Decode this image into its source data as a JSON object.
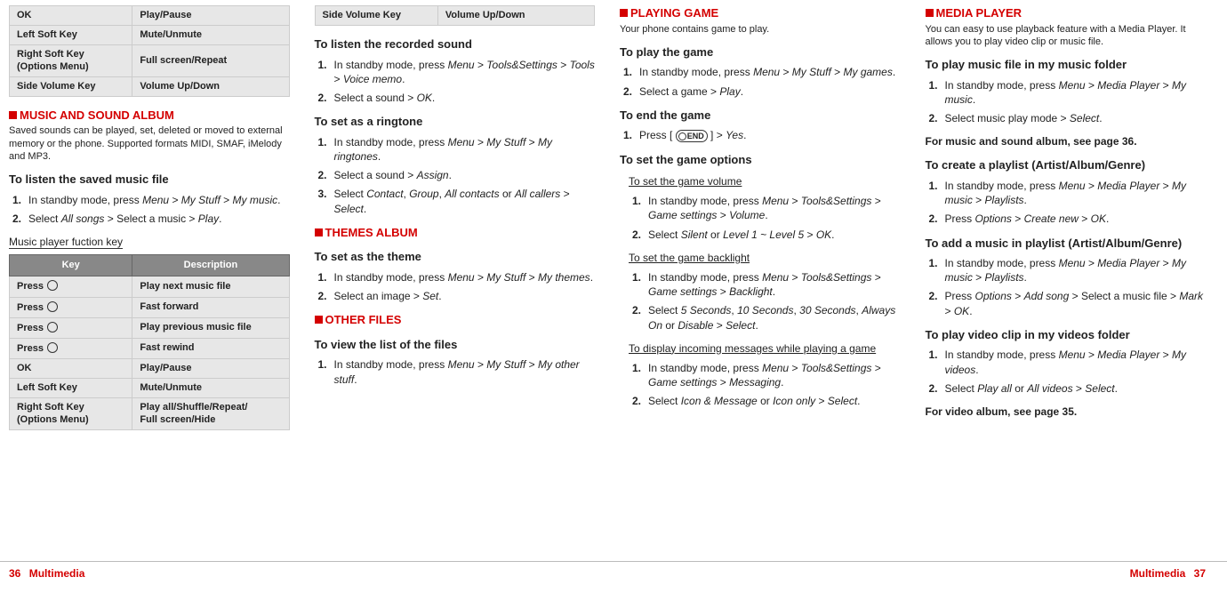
{
  "footer": {
    "left_num": "36",
    "left_name": "Multimedia",
    "right_name": "Multimedia",
    "right_num": "37"
  },
  "col1": {
    "top_table": [
      {
        "k": "OK",
        "d": "Play/Pause"
      },
      {
        "k": "Left Soft Key",
        "d": "Mute/Unmute"
      },
      {
        "k": "Right Soft Key\n(Options Menu)",
        "d": "Full screen/Repeat"
      },
      {
        "k": "Side Volume Key",
        "d": "Volume Up/Down"
      }
    ],
    "h1": "MUSIC AND SOUND ALBUM",
    "h1_sub": "Saved sounds can be played, set, deleted or moved to external memory or the phone. Supported formats MIDI, SMAF, iMelody and MP3.",
    "h2": "To listen the saved music file",
    "listen_list": [
      "In standby mode, press <i>Menu</i> > <i>My Stuff</i> > <i>My music</i>.",
      "Select <i>All songs</i> > Select a music > <i>Play</i>."
    ],
    "h3": "Music player fuction key",
    "table2_headers": {
      "key": "Key",
      "desc": "Description"
    },
    "table2": [
      {
        "k": "Press",
        "icon": true,
        "d": "Play next music file"
      },
      {
        "k": "Press",
        "icon": true,
        "d": "Fast forward"
      },
      {
        "k": "Press",
        "icon": true,
        "d": "Play previous music file"
      },
      {
        "k": "Press",
        "icon": true,
        "d": "Fast rewind"
      },
      {
        "k": "OK",
        "d": "Play/Pause"
      },
      {
        "k": "Left Soft Key",
        "d": "Mute/Unmute"
      },
      {
        "k": "Right Soft Key\n(Options Menu)",
        "d": "Play all/Shuffle/Repeat/\nFull screen/Hide"
      }
    ]
  },
  "col2": {
    "top_table": [
      {
        "k": "Side Volume Key",
        "d": "Volume Up/Down"
      }
    ],
    "h1": "To listen the recorded sound",
    "list1": [
      "In standby mode, press <i>Menu</i> > <i>Tools&Settings</i> > <i>Tools</i> > <i>Voice memo</i>.",
      "Select a sound > <i>OK</i>."
    ],
    "h2": "To set as a ringtone",
    "list2": [
      "In standby mode, press <i>Menu</i> > <i>My Stuff</i> > <i>My ringtones</i>.",
      "Select a sound > <i>Assign</i>.",
      "Select <i>Contact</i>, <i>Group</i>, <i>All contacts</i> or <i>All callers</i> > <i>Select</i>."
    ],
    "h3": "THEMES ALBUM",
    "h4": "To set as the theme",
    "list3": [
      "In standby mode, press <i>Menu</i> > <i>My Stuff</i> > <i>My themes</i>.",
      "Select an image > <i>Set</i>."
    ],
    "h5": "OTHER FILES",
    "h6": "To view the list of the files",
    "list4": [
      "In standby mode, press <i>Menu</i> > <i>My Stuff</i> > <i>My other stuff</i>."
    ]
  },
  "col3": {
    "h1": "PLAYING GAME",
    "h1_sub": "Your phone contains game to play.",
    "h2": "To play the game",
    "list1": [
      "In standby mode, press <i>Menu</i> > <i>My Stuff</i> > <i>My games</i>.",
      "Select a game > <i>Play</i>."
    ],
    "h3": "To end the game",
    "list2_pre": "Press [",
    "list2_post": "] > <i>Yes</i>.",
    "end_label": "END",
    "h4": "To set the game options",
    "u1": "To set the game volume",
    "list3": [
      "In standby mode, press <i>Menu</i> > <i>Tools&Settings</i> > <i>Game settings</i> > <i>Volume</i>.",
      "Select <i>Silent</i> or <i>Level 1 ~ Level 5</i> > <i>OK</i>."
    ],
    "u2": "To set the game backlight",
    "list4": [
      "In standby mode, press <i>Menu</i> > <i>Tools&Settings</i> > <i>Game settings</i> > <i>Backlight</i>.",
      "Select <i>5 Seconds</i>, <i>10 Seconds</i>, <i>30 Seconds</i>, <i>Always On</i> or <i>Disable</i> > <i>Select</i>."
    ],
    "u3": "To display incoming messages while playing a game",
    "list5": [
      "In standby mode, press <i>Menu</i> > <i>Tools&Settings</i> > <i>Game settings</i> > <i>Messaging</i>.",
      "Select <i>Icon & Message</i> or <i>Icon only</i> > <i>Select</i>."
    ]
  },
  "col4": {
    "h1": "MEDIA PLAYER",
    "h1_sub": "You can easy to use playback feature with a Media Player. It allows you to play video clip or music file.",
    "h2": "To play music file in my music folder",
    "list1": [
      "In standby mode, press <i>Menu</i> > <i>Media Player</i> > <i>My music</i>.",
      "Select music play mode > <i>Select</i>."
    ],
    "note1": "For music and sound album, see page 36.",
    "h3": "To create a playlist (Artist/Album/Genre)",
    "list2": [
      "In standby mode, press <i>Menu</i> > <i>Media Player</i> > <i>My music</i> > <i>Playlists</i>.",
      "Press <i>Options</i> > <i>Create new</i> > <i>OK</i>."
    ],
    "h4": "To add a music in playlist (Artist/Album/Genre)",
    "list3": [
      "In standby mode, press <i>Menu</i> > <i>Media Player</i> > <i>My music</i> > <i>Playlists</i>.",
      "Press <i>Options</i> > <i>Add song</i> > Select a music file > <i>Mark</i> > <i>OK</i>."
    ],
    "h5": "To play video clip in my videos folder",
    "list4": [
      "In standby mode, press <i>Menu</i> > <i>Media Player</i> > <i>My videos</i>.",
      "Select <i>Play all</i> or <i>All videos</i> > <i>Select</i>."
    ],
    "note2": "For video album, see page 35."
  }
}
